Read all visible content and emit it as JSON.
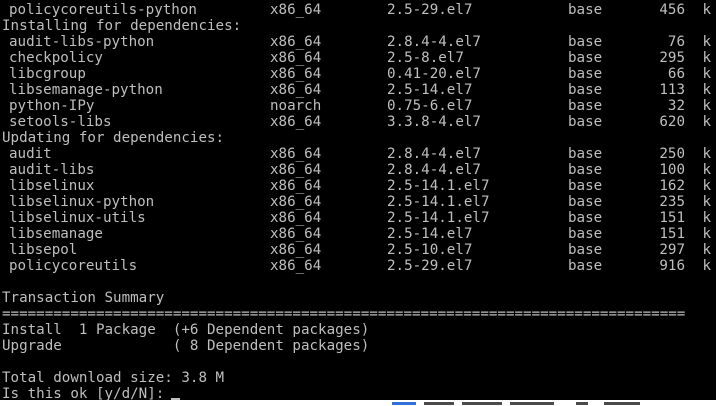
{
  "terminal": {
    "first_row": {
      "name": "policycoreutils-python",
      "arch": "x86_64",
      "version": "2.5-29.el7",
      "repo": "base",
      "size": "456",
      "unit": "k"
    },
    "installing_header": "Installing for dependencies:",
    "installing": [
      {
        "name": "audit-libs-python",
        "arch": "x86_64",
        "version": "2.8.4-4.el7",
        "repo": "base",
        "size": "76",
        "unit": "k"
      },
      {
        "name": "checkpolicy",
        "arch": "x86_64",
        "version": "2.5-8.el7",
        "repo": "base",
        "size": "295",
        "unit": "k"
      },
      {
        "name": "libcgroup",
        "arch": "x86_64",
        "version": "0.41-20.el7",
        "repo": "base",
        "size": "66",
        "unit": "k"
      },
      {
        "name": "libsemanage-python",
        "arch": "x86_64",
        "version": "2.5-14.el7",
        "repo": "base",
        "size": "113",
        "unit": "k"
      },
      {
        "name": "python-IPy",
        "arch": "noarch",
        "version": "0.75-6.el7",
        "repo": "base",
        "size": "32",
        "unit": "k"
      },
      {
        "name": "setools-libs",
        "arch": "x86_64",
        "version": "3.3.8-4.el7",
        "repo": "base",
        "size": "620",
        "unit": "k"
      }
    ],
    "updating_header": "Updating for dependencies:",
    "updating": [
      {
        "name": "audit",
        "arch": "x86_64",
        "version": "2.8.4-4.el7",
        "repo": "base",
        "size": "250",
        "unit": "k"
      },
      {
        "name": "audit-libs",
        "arch": "x86_64",
        "version": "2.8.4-4.el7",
        "repo": "base",
        "size": "100",
        "unit": "k"
      },
      {
        "name": "libselinux",
        "arch": "x86_64",
        "version": "2.5-14.1.el7",
        "repo": "base",
        "size": "162",
        "unit": "k"
      },
      {
        "name": "libselinux-python",
        "arch": "x86_64",
        "version": "2.5-14.1.el7",
        "repo": "base",
        "size": "235",
        "unit": "k"
      },
      {
        "name": "libselinux-utils",
        "arch": "x86_64",
        "version": "2.5-14.1.el7",
        "repo": "base",
        "size": "151",
        "unit": "k"
      },
      {
        "name": "libsemanage",
        "arch": "x86_64",
        "version": "2.5-14.el7",
        "repo": "base",
        "size": "151",
        "unit": "k"
      },
      {
        "name": "libsepol",
        "arch": "x86_64",
        "version": "2.5-10.el7",
        "repo": "base",
        "size": "297",
        "unit": "k"
      },
      {
        "name": "policycoreutils",
        "arch": "x86_64",
        "version": "2.5-29.el7",
        "repo": "base",
        "size": "916",
        "unit": "k"
      }
    ],
    "summary_title": "Transaction Summary",
    "separator": "================================================================================",
    "install_line": "Install  1 Package  (+6 Dependent packages)",
    "upgrade_line": "Upgrade             ( 8 Dependent packages)",
    "download_size": "Total download size: 3.8 M",
    "prompt": "Is this ok [y/d/N]:"
  },
  "colors": {
    "background": "#000000",
    "text": "#bfbfbf",
    "desktop": "#ffffff",
    "taskbar_blue": "#2f6fd6",
    "taskbar_gray": "#4a4a4a"
  }
}
